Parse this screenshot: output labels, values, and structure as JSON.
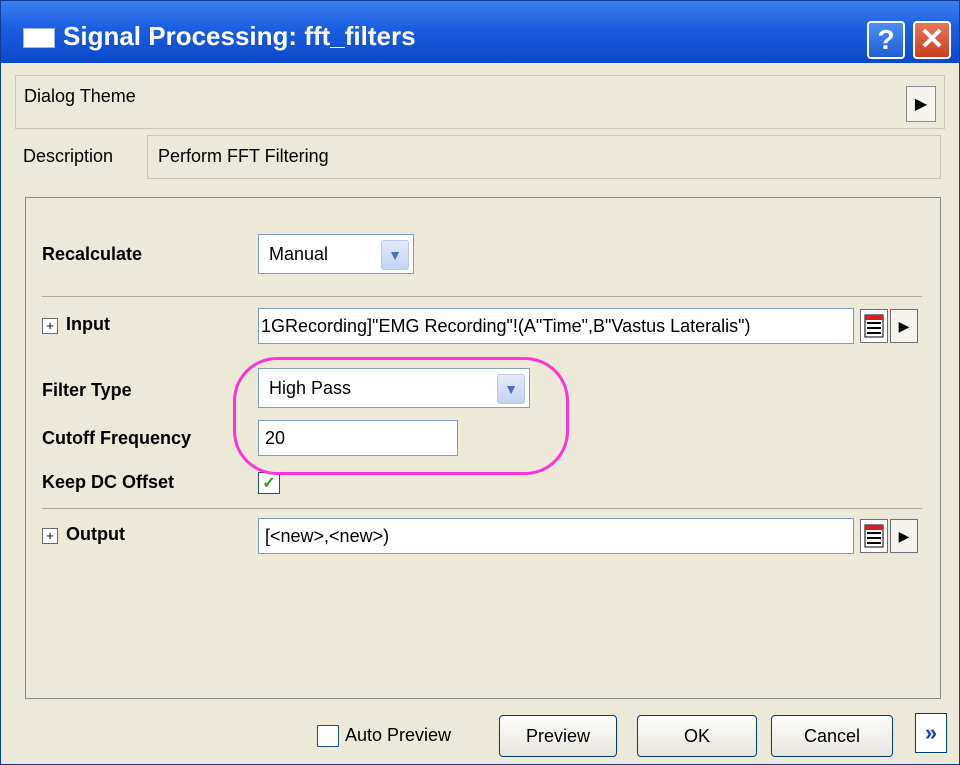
{
  "window": {
    "title": "Signal Processing: fft_filters",
    "help_label": "?",
    "close_label": "✕"
  },
  "dialog_theme": {
    "label": "Dialog Theme",
    "arrow": "▶"
  },
  "description": {
    "label": "Description",
    "value": "Perform FFT Filtering"
  },
  "form": {
    "recalculate": {
      "label": "Recalculate",
      "value": "Manual"
    },
    "input": {
      "expander": "+",
      "label": "Input",
      "value": "1GRecording]\"EMG Recording\"!(A\"Time\",B\"Vastus Lateralis\")",
      "menu_arrow": "▶"
    },
    "filter_type": {
      "label": "Filter Type",
      "value": "High Pass"
    },
    "cutoff_frequency": {
      "label": "Cutoff Frequency",
      "value": "20"
    },
    "keep_dc_offset": {
      "label": "Keep DC Offset",
      "checked": true,
      "check_glyph": "✓"
    },
    "output": {
      "expander": "+",
      "label": "Output",
      "value": "[<new>,<new>)",
      "menu_arrow": "▶"
    }
  },
  "dropdown_arrow": "▼",
  "footer": {
    "auto_preview_label": "Auto Preview",
    "auto_preview_checked": false,
    "preview_label": "Preview",
    "ok_label": "OK",
    "cancel_label": "Cancel",
    "more_label": "»"
  },
  "colors": {
    "title_bar": "#1a5ee0",
    "highlight_ellipse": "#ff33d6",
    "check_mark": "#21a121"
  }
}
